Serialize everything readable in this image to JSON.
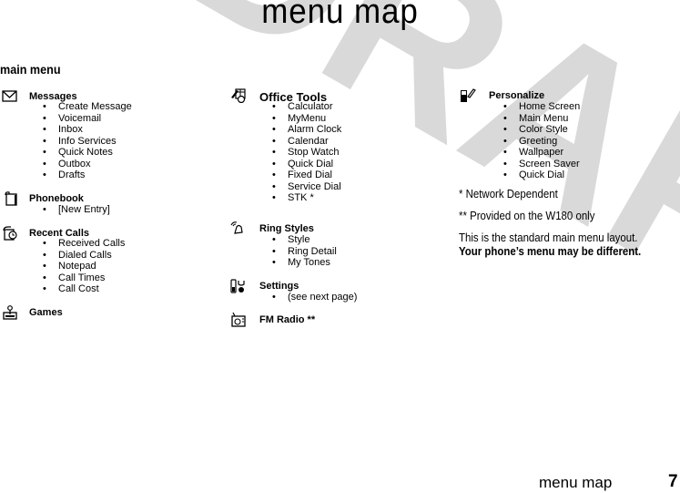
{
  "page": {
    "title": "menu map",
    "watermark": "DRAFT",
    "footer_label": "menu map",
    "page_number": "7"
  },
  "main_menu": {
    "heading": "main menu",
    "columns": [
      {
        "items": [
          {
            "icon": "envelope-icon",
            "label": "Messages",
            "subitems": [
              "Create Message",
              "Voicemail",
              "Inbox",
              "Info Services",
              "Quick Notes",
              "Outbox",
              "Drafts"
            ]
          },
          {
            "icon": "phonebook-icon",
            "label": "Phonebook",
            "subitems": [
              "[New Entry]"
            ]
          },
          {
            "icon": "recent-calls-icon",
            "label": "Recent Calls",
            "subitems": [
              "Received Calls",
              "Dialed Calls",
              "Notepad",
              "Call Times",
              "Call Cost"
            ]
          },
          {
            "icon": "joystick-icon",
            "label": "Games",
            "subitems": []
          }
        ]
      },
      {
        "items": [
          {
            "icon": "office-tools-icon",
            "label": "Office Tools",
            "subitems": [
              "Calculator",
              "MyMenu",
              "Alarm Clock",
              "Calendar",
              "Stop Watch",
              "Quick Dial",
              "Fixed Dial",
              "Service Dial",
              "STK *"
            ]
          },
          {
            "icon": "ringing-bell-icon",
            "label": "Ring Styles",
            "subitems": [
              "Style",
              "Ring Detail",
              "My Tones"
            ]
          },
          {
            "icon": "settings-icon",
            "label": "Settings",
            "subitems": [
              "(see next page)"
            ]
          },
          {
            "icon": "radio-icon",
            "label": "FM Radio **",
            "subitems": []
          }
        ]
      },
      {
        "items": [
          {
            "icon": "personalize-phone-icon",
            "label": "Personalize",
            "subitems": [
              "Home Screen",
              "Main Menu",
              "Color Style",
              "Greeting",
              "Wallpaper",
              "Screen Saver",
              "Quick Dial"
            ]
          }
        ]
      }
    ]
  },
  "notes": {
    "network_dependent": "* Network Dependent",
    "w180_only": "** Provided on the W180 only",
    "standard_layout": "This is the standard main menu layout.",
    "disclaimer": "Your phone’s menu may be different."
  }
}
